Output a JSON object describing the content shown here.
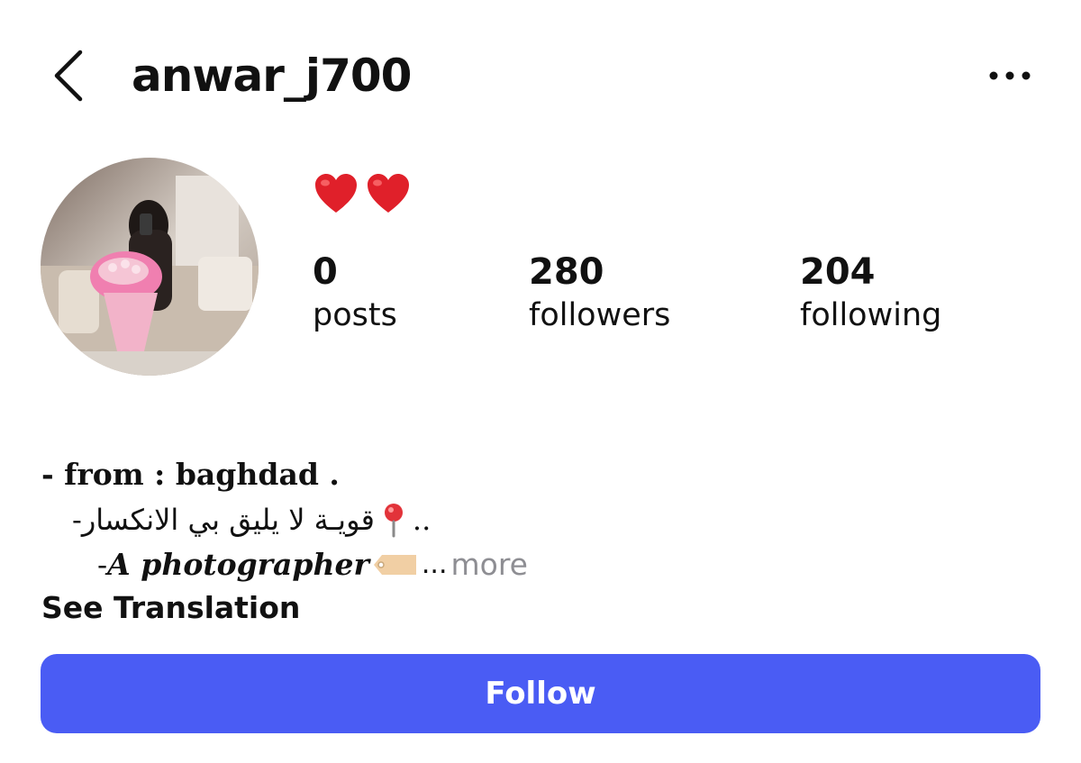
{
  "header": {
    "username": "anwar_j700",
    "back_icon": "chevron-left-icon",
    "more_icon": "more-horizontal-icon"
  },
  "profile": {
    "avatar_alt": "profile photo",
    "name_emoji": "❤️❤️",
    "stats": [
      {
        "value": "0",
        "label": "posts"
      },
      {
        "value": "280",
        "label": "followers"
      },
      {
        "value": "204",
        "label": "following"
      }
    ]
  },
  "bio": {
    "line1": "- from : baghdad .",
    "line2_prefix": "- ",
    "line2_arabic": "قويـة لا يليق بي الانكسار",
    "line2_suffix": " ..",
    "line3_prefix": "- ",
    "line3_text": "𝑨 photographer",
    "ellipsis": "...",
    "more_label": "more"
  },
  "see_translation_label": "See Translation",
  "follow_label": "Follow",
  "colors": {
    "follow_bg": "#4a5cf4",
    "muted_text": "#8e8e93",
    "heart": "#e0202a"
  }
}
